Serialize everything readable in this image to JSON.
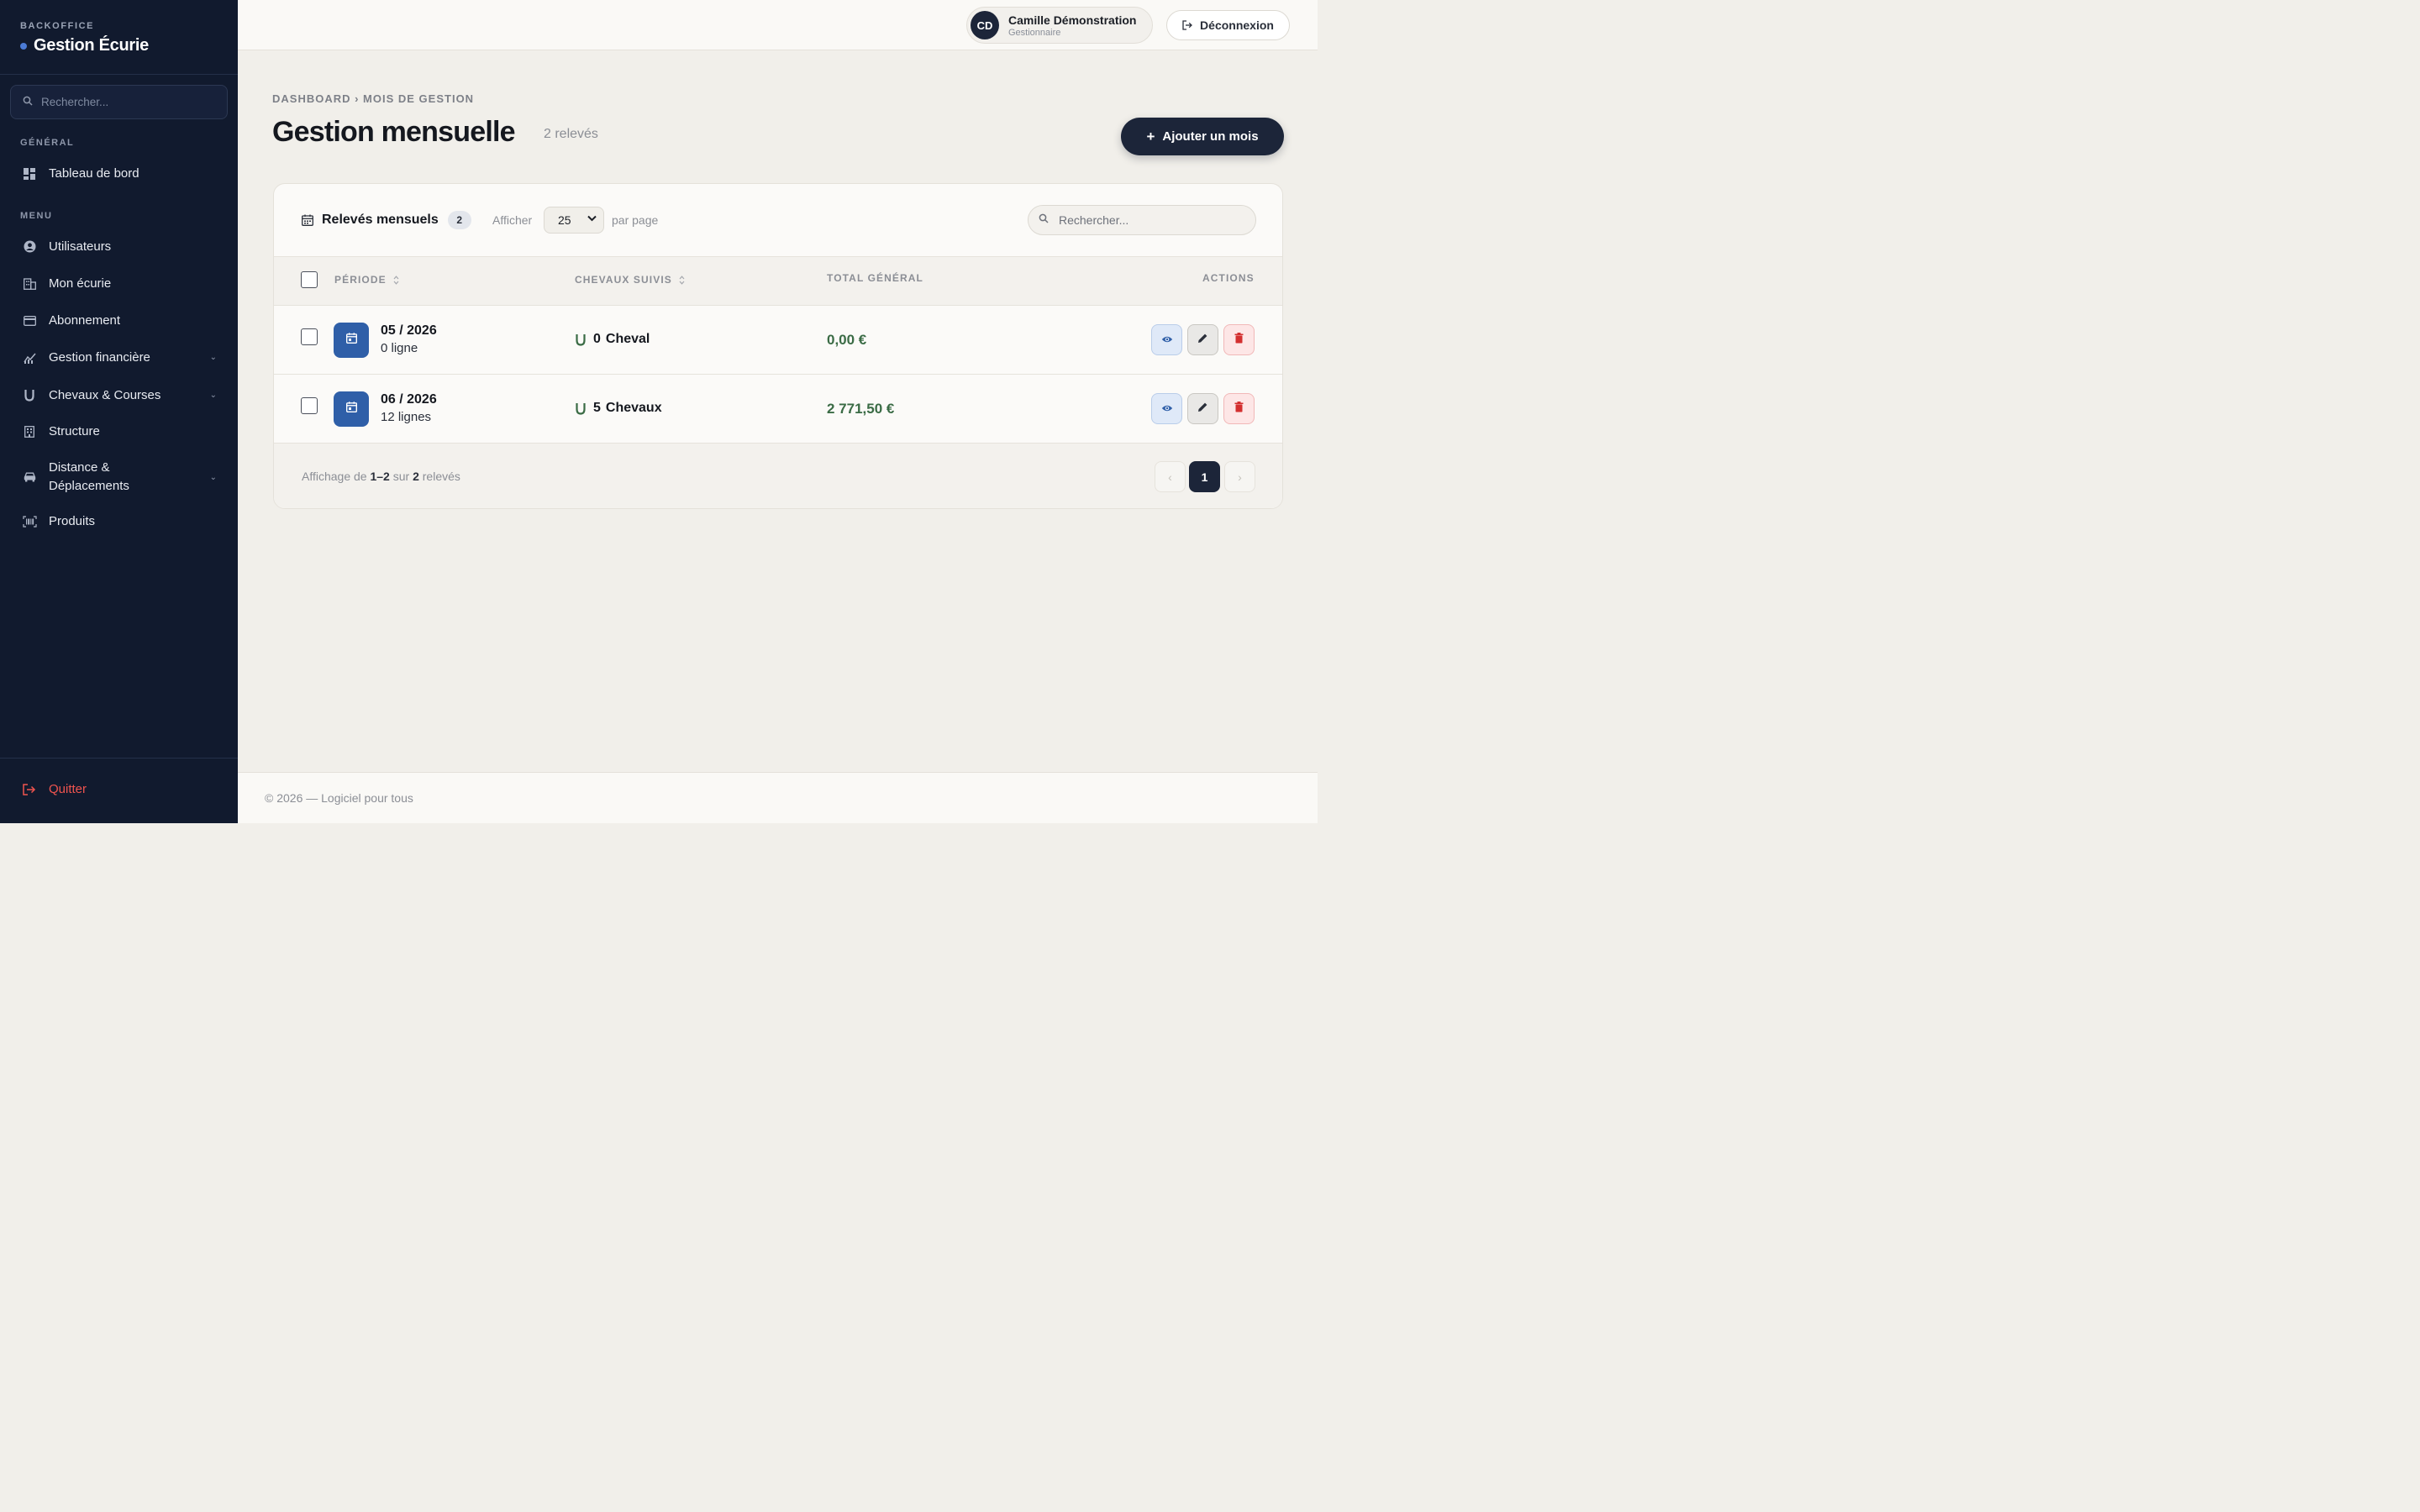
{
  "sidebar": {
    "kicker": "BACKOFFICE",
    "title": "Gestion Écurie",
    "search_placeholder": "Rechercher...",
    "section_general": "GÉNÉRAL",
    "section_menu": "MENU",
    "items": [
      {
        "label": "Tableau de bord",
        "icon": "dashboard-icon"
      },
      {
        "label": "Utilisateurs",
        "icon": "user-circle-icon"
      },
      {
        "label": "Mon écurie",
        "icon": "building-icon"
      },
      {
        "label": "Abonnement",
        "icon": "credit-card-icon"
      },
      {
        "label": "Gestion financière",
        "icon": "finance-icon"
      },
      {
        "label": "Chevaux & Courses",
        "icon": "horseshoe-icon"
      },
      {
        "label": "Structure",
        "icon": "structure-icon"
      },
      {
        "label": "Distance & Déplacements",
        "icon": "car-icon"
      },
      {
        "label": "Produits",
        "icon": "barcode-icon"
      }
    ],
    "quit_label": "Quitter"
  },
  "topbar": {
    "avatar_initials": "CD",
    "user_name": "Camille Démonstration",
    "user_role": "Gestionnaire",
    "logout_label": "Déconnexion"
  },
  "main": {
    "breadcrumb": "DASHBOARD › MOIS DE GESTION",
    "title": "Gestion mensuelle",
    "count": "2 relevés",
    "add_label": "Ajouter un mois"
  },
  "card": {
    "title": "Relevés mensuels",
    "count": "2",
    "show_label": "Afficher",
    "per_page_value": "25",
    "per_page_label": "par page",
    "search_placeholder": "Rechercher..."
  },
  "table": {
    "headers": {
      "period": "PÉRIODE",
      "horses": "CHEVAUX SUIVIS",
      "total": "TOTAL GÉNÉRAL",
      "actions": "ACTIONS"
    },
    "rows": [
      {
        "period": "05 / 2026",
        "lines": "0 ligne",
        "horse_count": "0",
        "horse_word": "Cheval",
        "total": "0,00 €"
      },
      {
        "period": "06 / 2026",
        "lines": "12 lignes",
        "horse_count": "5",
        "horse_word": "Chevaux",
        "total": "2 771,50 €"
      }
    ]
  },
  "pagination": {
    "prefix": "Affichage de",
    "range": "1–2",
    "mid": "sur",
    "total": "2",
    "suffix": "relevés",
    "prev": "‹",
    "current": "1",
    "next": "›"
  },
  "footer": {
    "text": "© 2026 — Logiciel pour tous"
  },
  "colors": {
    "sidebar_bg": "#111a2e",
    "accent": "#2f5fa8",
    "total_green": "#3a6b45",
    "danger": "#f0544f"
  }
}
